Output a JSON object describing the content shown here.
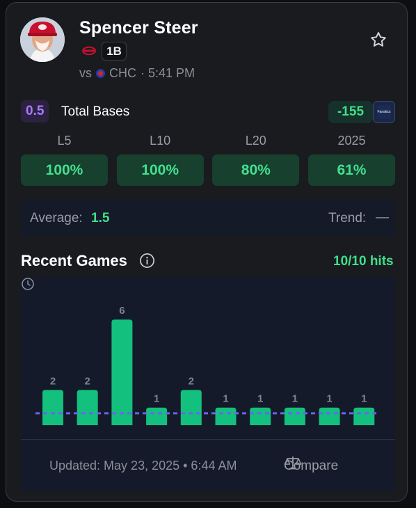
{
  "player": {
    "name": "Spencer Steer",
    "position": "1B",
    "team_icon": "reds-logo-icon",
    "opponent_prefix": "vs",
    "opponent_icon": "cubs-logo-icon",
    "opponent": "CHC",
    "game_time": "· 5:41 PM"
  },
  "prop": {
    "line": "0.5",
    "market": "Total Bases",
    "odds": "-155",
    "sportsbook_icon": "fanatics-icon",
    "sportsbook_label": "Fanatics"
  },
  "hit_rates": [
    {
      "label": "L5",
      "value": "100%"
    },
    {
      "label": "L10",
      "value": "100%"
    },
    {
      "label": "L20",
      "value": "80%"
    },
    {
      "label": "2025",
      "value": "61%"
    }
  ],
  "summary": {
    "average_label": "Average:",
    "average_value": "1.5",
    "trend_label": "Trend:",
    "trend_value": "—"
  },
  "recent_games": {
    "title": "Recent Games",
    "hits_text": "10/10 hits"
  },
  "chart_data": {
    "type": "bar",
    "values": [
      2,
      2,
      6,
      1,
      2,
      1,
      1,
      1,
      1,
      1
    ],
    "threshold": 0.5,
    "bar_color": "#13c07d",
    "threshold_color": "#6d63f0",
    "label_color": "#7e828e"
  },
  "footer": {
    "updated_text": "Updated: May 23, 2025 • 6:44 AM",
    "compare_label": "Compare"
  },
  "colors": {
    "accent_green": "#3ee08a",
    "line_purple": "#a77bff"
  }
}
